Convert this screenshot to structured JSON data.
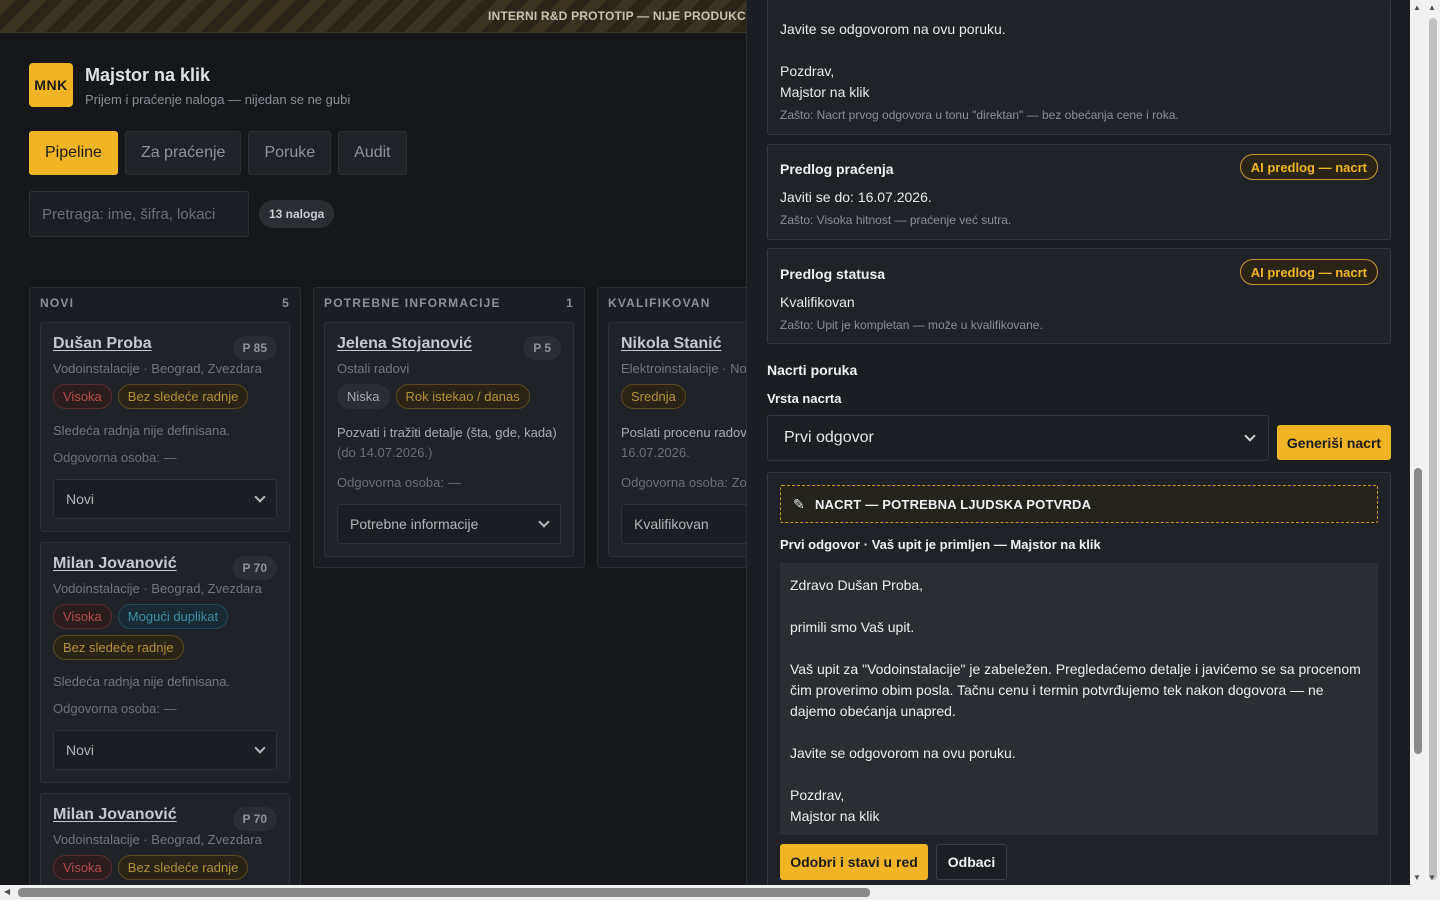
{
  "banner": "INTERNI R&D PROTOTIP — NIJE PRODUKCI...",
  "brand": {
    "logo": "MNK",
    "title": "Majstor na klik",
    "subtitle": "Prijem i praćenje naloga — nijedan se ne gubi"
  },
  "tabs": [
    {
      "label": "Pipeline",
      "active": true
    },
    {
      "label": "Za praćenje"
    },
    {
      "label": "Poruke"
    },
    {
      "label": "Audit"
    }
  ],
  "search": {
    "placeholder": "Pretraga: ime, šifra, lokaci"
  },
  "count": "13 naloga",
  "columns": [
    {
      "title": "NOVI",
      "count": "5",
      "cards": [
        {
          "name": "Dušan Proba",
          "priority": "P 85",
          "meta": "Vodoinstalacije · Beograd, Zvezdara",
          "badges": [
            {
              "label": "Visoka",
              "tone": "red"
            },
            {
              "label": "Bez sledeće radnje",
              "tone": "yellow"
            }
          ],
          "next": "Sledeća radnja nije definisana.",
          "responsible": "Odgovorna osoba: —",
          "status": "Novi"
        },
        {
          "name": "Milan Jovanović",
          "priority": "P 70",
          "meta": "Vodoinstalacije · Beograd, Zvezdara",
          "badges": [
            {
              "label": "Visoka",
              "tone": "red"
            },
            {
              "label": "Mogući duplikat",
              "tone": "blue"
            },
            {
              "label": "Bez sledeće radnje",
              "tone": "yellow"
            }
          ],
          "next": "Sledeća radnja nije definisana.",
          "responsible": "Odgovorna osoba: —",
          "status": "Novi"
        },
        {
          "name": "Milan Jovanović",
          "priority": "P 70",
          "meta": "Vodoinstalacije · Beograd, Zvezdara",
          "badges": [
            {
              "label": "Visoka",
              "tone": "red"
            },
            {
              "label": "Bez sledeće radnje",
              "tone": "yellow"
            }
          ]
        }
      ]
    },
    {
      "title": "POTREBNE INFORMACIJE",
      "count": "1",
      "cards": [
        {
          "name": "Jelena Stojanović",
          "priority": "P 5",
          "meta": "Ostali radovi",
          "badges": [
            {
              "label": "Niska",
              "tone": "grey"
            },
            {
              "label": "Rok istekao / danas",
              "tone": "yellow"
            }
          ],
          "next": "Pozvati i tražiti detalje (šta, gde, kada)",
          "next_date": "(do 14.07.2026.)",
          "responsible": "Odgovorna osoba: —",
          "status": "Potrebne informacije"
        }
      ]
    },
    {
      "title": "KVALIFIKOVAN",
      "count": "",
      "cards": [
        {
          "name": "Nikola Stanić",
          "priority": "",
          "meta": "Elektroinstalacije · Novi",
          "badges": [
            {
              "label": "Srednja",
              "tone": "yellow"
            }
          ],
          "next": "Poslati procenu radova",
          "next_date": "16.07.2026.",
          "responsible": "Odgovorna osoba: Zo",
          "status": "Kvalifikovan"
        }
      ]
    }
  ],
  "drawer": {
    "top_box": {
      "line1": "Javite se odgovorom na ovu poruku.",
      "line2": "Pozdrav,",
      "line3": "Majstor na klik",
      "why": "Zašto: Nacrt prvog odgovora u tonu \"direktan\" — bez obećanja cene i roka."
    },
    "followup": {
      "title": "Predlog praćenja",
      "badge": "AI predlog — nacrt",
      "text": "Javiti se do: 16.07.2026.",
      "why": "Zašto: Visoka hitnost — praćenje već sutra."
    },
    "status": {
      "title": "Predlog statusa",
      "badge": "AI predlog — nacrt",
      "text": "Kvalifikovan",
      "why": "Zašto: Upit je kompletan — može u kvalifikovane."
    },
    "drafts_title": "Nacrti poruka",
    "draft_type_label": "Vrsta nacrta",
    "draft_type_value": "Prvi odgovor",
    "generate_label": "Generiši nacrt",
    "warning": "NACRT — POTREBNA LJUDSKA POTVRDA",
    "draft_subject": "Prvi odgovor · Vaš upit je primljen — Majstor na klik",
    "draft_body": {
      "greeting": "Zdravo Dušan Proba,",
      "p1": "primili smo Vaš upit.",
      "p2": "Vaš upit za \"Vodoinstalacije\" je zabeležen. Pregledaćemo detalje i javićemo se sa procenom čim proverimo obim posla. Tačnu cenu i termin potvrđujemo tek nakon dogovora — ne dajemo obećanja unapred.",
      "p3": "Javite se odgovorom na ovu poruku.",
      "sign1": "Pozdrav,",
      "sign2": "Majstor na klik"
    },
    "approve_label": "Odobri i stavi u red",
    "reject_label": "Odbaci"
  },
  "colors": {
    "accent": "#f0b424",
    "bg": "#15171b"
  }
}
